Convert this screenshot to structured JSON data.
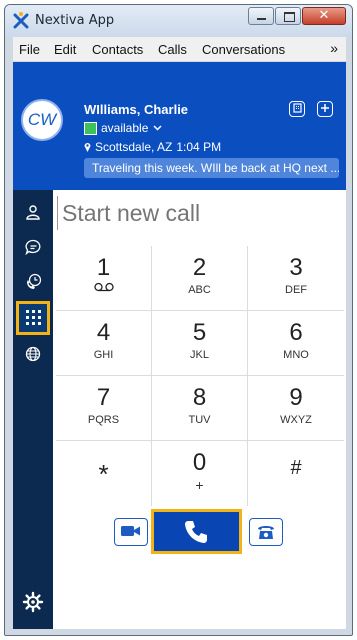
{
  "window": {
    "title": "Nextiva App",
    "close_glyph": "✕"
  },
  "menu": {
    "items": [
      "File",
      "Edit",
      "Contacts",
      "Calls",
      "Conversations"
    ],
    "more": "»"
  },
  "profile": {
    "initials": "CW",
    "name": "WIlliams, Charlie",
    "status": "available",
    "status_color": "#3dc15a",
    "location": "Scottsdale, AZ",
    "time": "1:04 PM",
    "message": "Traveling this week. WIll be back at HQ next ..."
  },
  "sidebar": {
    "items": [
      {
        "icon": "contacts-icon"
      },
      {
        "icon": "chat-icon"
      },
      {
        "icon": "call-history-icon"
      },
      {
        "icon": "dialpad-icon",
        "active": true
      },
      {
        "icon": "globe-icon"
      }
    ],
    "settings_icon": "gear-icon"
  },
  "dialer": {
    "placeholder": "Start new call",
    "keys": [
      {
        "digit": "1",
        "letters": ""
      },
      {
        "digit": "2",
        "letters": "ABC"
      },
      {
        "digit": "3",
        "letters": "DEF"
      },
      {
        "digit": "4",
        "letters": "GHI"
      },
      {
        "digit": "5",
        "letters": "JKL"
      },
      {
        "digit": "6",
        "letters": "MNO"
      },
      {
        "digit": "7",
        "letters": "PQRS"
      },
      {
        "digit": "8",
        "letters": "TUV"
      },
      {
        "digit": "9",
        "letters": "WXYZ"
      },
      {
        "digit": "*",
        "letters": ""
      },
      {
        "digit": "0",
        "letters": "+"
      },
      {
        "digit": "#",
        "letters": ""
      }
    ]
  },
  "colors": {
    "brand_blue": "#0a4ec0",
    "sidebar_bg": "#0c2a4f",
    "highlight": "#f3b317"
  }
}
